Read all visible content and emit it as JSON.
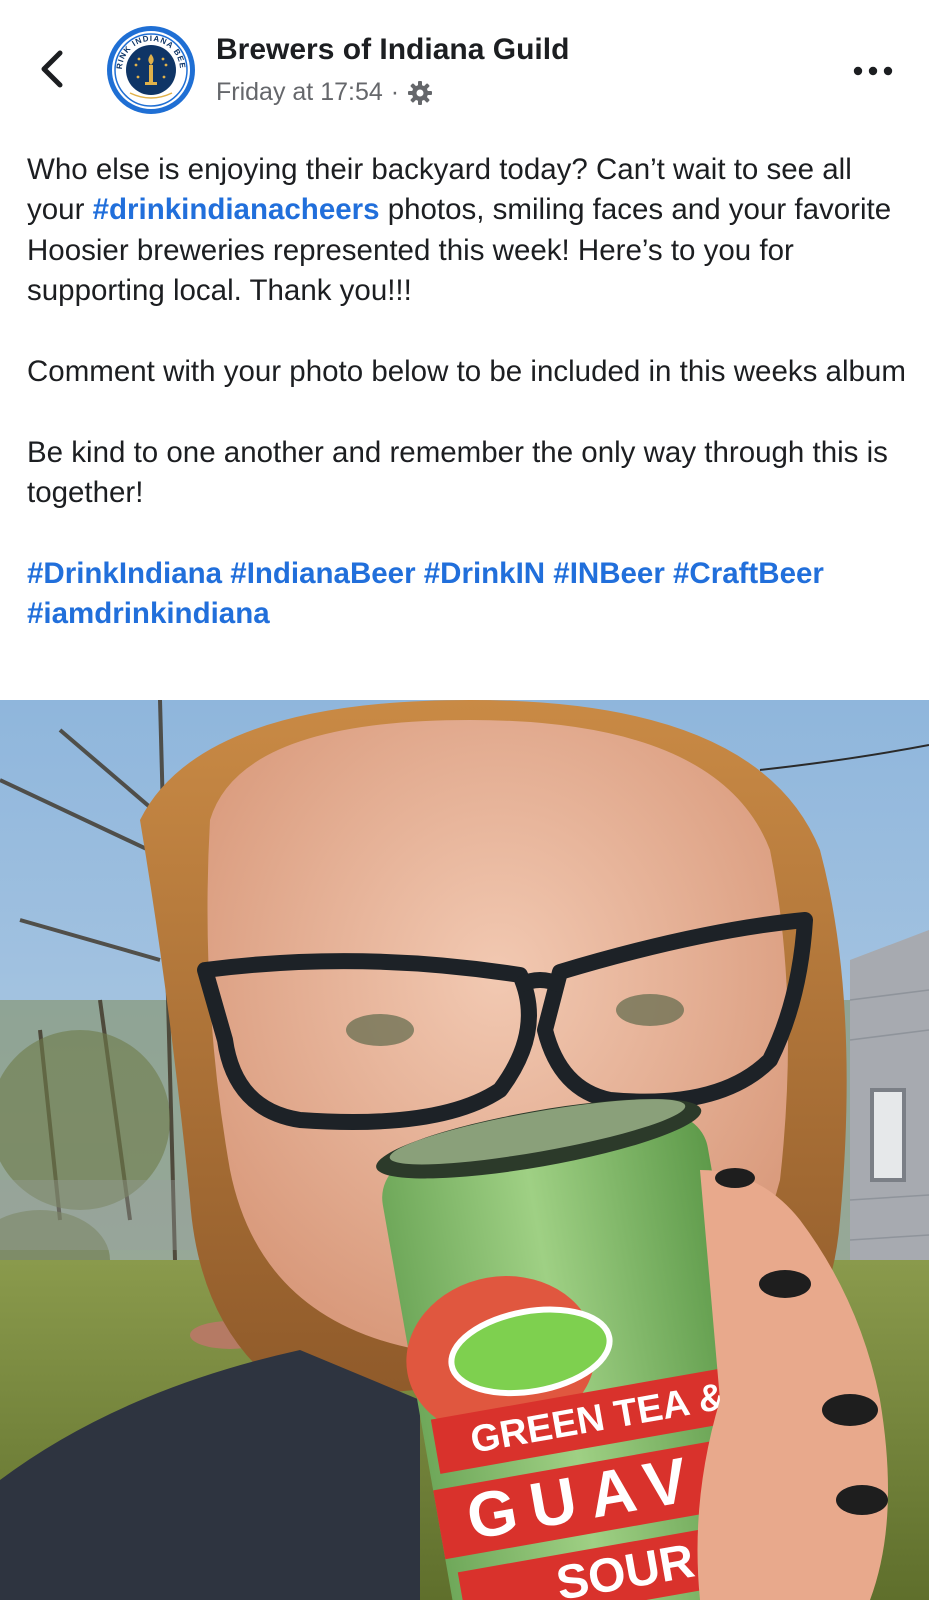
{
  "header": {
    "back_icon": "chevron-left-icon",
    "page_name": "Brewers of Indiana Guild",
    "timestamp": "Friday at 17:54",
    "separator": "·",
    "privacy_icon": "gear-icon",
    "more_icon": "more-horizontal-icon",
    "avatar": {
      "text_top": "DRINK INDIANA BEER",
      "colors": {
        "ring": "#1f6fd4",
        "inner": "#0f3566",
        "gold": "#e0b14a"
      }
    }
  },
  "post": {
    "p1_before": "Who else is enjoying their backyard today? Can’t wait to see all your ",
    "p1_hashtag": "#drinkindianacheers",
    "p1_after": " photos, smiling faces and your favorite Hoosier breweries represented this week! Here’s to you for supporting local. Thank you!!!",
    "p2": "Comment with your photo below to be included in this weeks album",
    "p3": "Be kind to one another and remember the only way through this is together!",
    "hashtags": [
      "#DrinkIndiana",
      "#IndianaBeer",
      "#DrinkIN",
      "#INBeer",
      "#CraftBeer",
      "#iamdrinkindiana"
    ]
  },
  "photo": {
    "can_label_1": "GREEN TEA &",
    "can_label_2": "GUAVA",
    "can_label_3": "SOUR"
  },
  "colors": {
    "hashtag": "#216fdb",
    "meta_text": "#65676b",
    "text": "#1c1e21"
  }
}
